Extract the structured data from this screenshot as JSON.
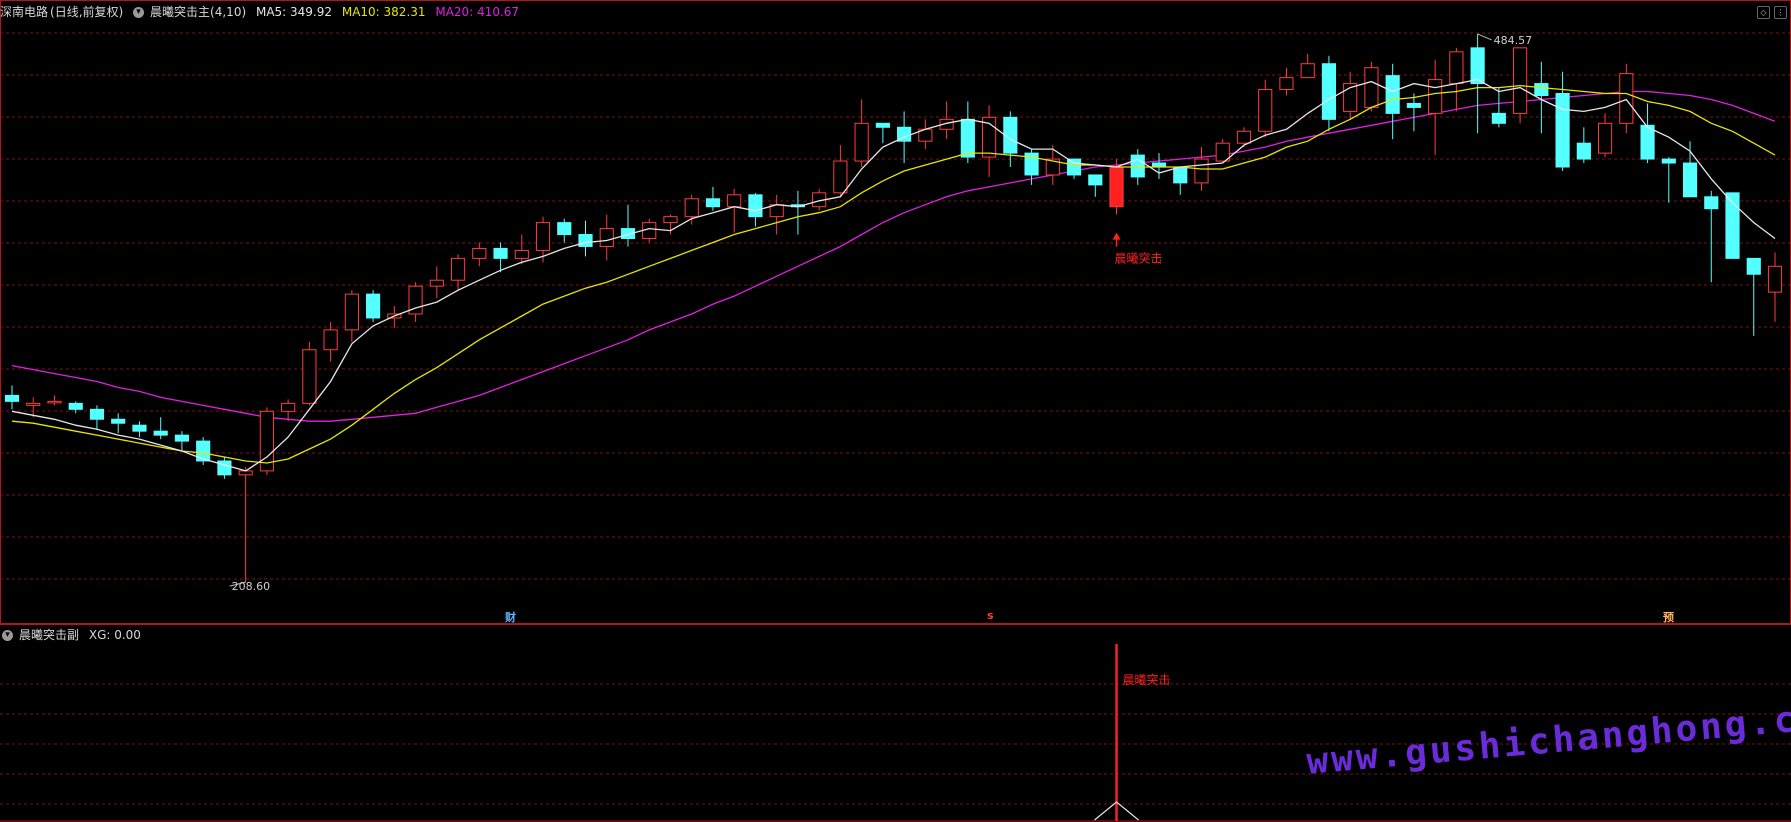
{
  "header": {
    "stock_name": "深南电路",
    "period": "(日线,前复权)",
    "indicator_name": "晨曦突击主",
    "indicator_params": "(4,10)",
    "ma5_label": "MA5: 349.92",
    "ma10_label": "MA10: 382.31",
    "ma20_label": "MA20: 410.67"
  },
  "sub_header": {
    "indicator_name": "晨曦突击副",
    "xg_label": "XG: 0.00"
  },
  "annotations": {
    "high_price": "484.57",
    "low_price": "208.60",
    "signal_main": "晨曦突击",
    "signal_sub": "晨曦突击",
    "marker_cai": "财",
    "marker_s": "s",
    "marker_yu": "预"
  },
  "watermark": "www.gushichanghong.com",
  "colors": {
    "up": "#ff3c3c",
    "down": "#54ffff",
    "ma5": "#e6e6e6",
    "ma10": "#e6e600",
    "ma20": "#e020e0",
    "grid": "#7a1414",
    "signal": "#ff2020"
  },
  "chart_data": {
    "type": "candlestick",
    "ylim": [
      200,
      490
    ],
    "signal_index": 52,
    "candles": [
      [
        303,
        300,
        308,
        296
      ],
      [
        298,
        299,
        302,
        292
      ],
      [
        300,
        300,
        303,
        298
      ],
      [
        299,
        296,
        300,
        294
      ],
      [
        296,
        291,
        298,
        286
      ],
      [
        291,
        289,
        294,
        284
      ],
      [
        288,
        285,
        290,
        282
      ],
      [
        285,
        283,
        292,
        281
      ],
      [
        283,
        280,
        285,
        275
      ],
      [
        280,
        270,
        282,
        268
      ],
      [
        270,
        263,
        272,
        261
      ],
      [
        263,
        265,
        267,
        209
      ],
      [
        265,
        295,
        297,
        263
      ],
      [
        295,
        299,
        301,
        290
      ],
      [
        299,
        326,
        330,
        298
      ],
      [
        326,
        336,
        340,
        320
      ],
      [
        336,
        354,
        356,
        330
      ],
      [
        354,
        342,
        356,
        340
      ],
      [
        342,
        344,
        348,
        337
      ],
      [
        344,
        358,
        360,
        340
      ],
      [
        358,
        361,
        368,
        352
      ],
      [
        361,
        372,
        374,
        356
      ],
      [
        372,
        377,
        380,
        368
      ],
      [
        377,
        372,
        380,
        365
      ],
      [
        372,
        376,
        384,
        369
      ],
      [
        376,
        390,
        393,
        370
      ],
      [
        390,
        384,
        392,
        380
      ],
      [
        384,
        378,
        391,
        373
      ],
      [
        378,
        387,
        394,
        371
      ],
      [
        387,
        382,
        399,
        378
      ],
      [
        382,
        390,
        392,
        380
      ],
      [
        390,
        393,
        394,
        384
      ],
      [
        393,
        402,
        404,
        389
      ],
      [
        402,
        398,
        408,
        396
      ],
      [
        398,
        404,
        407,
        385
      ],
      [
        404,
        393,
        405,
        388
      ],
      [
        393,
        399,
        404,
        384
      ],
      [
        399,
        398,
        406,
        384
      ],
      [
        398,
        405,
        407,
        396
      ],
      [
        405,
        421,
        429,
        403
      ],
      [
        421,
        440,
        452,
        418
      ],
      [
        440,
        438,
        440,
        430
      ],
      [
        438,
        431,
        446,
        420
      ],
      [
        431,
        437,
        442,
        427
      ],
      [
        437,
        442,
        451,
        432
      ],
      [
        442,
        423,
        451,
        420
      ],
      [
        423,
        443,
        449,
        413
      ],
      [
        443,
        425,
        446,
        418
      ],
      [
        425,
        414,
        427,
        409
      ],
      [
        414,
        422,
        429,
        409
      ],
      [
        422,
        414,
        420,
        412
      ],
      [
        414,
        409,
        411,
        403
      ],
      [
        398,
        418,
        422,
        394
      ],
      [
        424,
        413,
        427,
        409
      ],
      [
        420,
        418,
        425,
        412
      ],
      [
        418,
        410,
        416,
        404
      ],
      [
        410,
        422,
        428,
        406
      ],
      [
        421,
        430,
        432,
        420
      ],
      [
        430,
        436,
        438,
        428
      ],
      [
        436,
        457,
        462,
        433
      ],
      [
        457,
        463,
        468,
        454
      ],
      [
        463,
        470,
        475,
        464
      ],
      [
        470,
        442,
        474,
        436
      ],
      [
        446,
        460,
        466,
        442
      ],
      [
        448,
        468,
        471,
        446
      ],
      [
        464,
        445,
        470,
        432
      ],
      [
        450,
        448,
        455,
        436
      ],
      [
        445,
        462,
        472,
        424
      ],
      [
        460,
        476,
        478,
        446
      ],
      [
        478,
        460,
        485,
        435
      ],
      [
        445,
        440,
        458,
        438
      ],
      [
        445,
        478,
        475,
        440
      ],
      [
        460,
        454,
        471,
        435
      ],
      [
        455,
        418,
        466,
        416
      ],
      [
        430,
        422,
        438,
        420
      ],
      [
        425,
        440,
        445,
        423
      ],
      [
        440,
        465,
        470,
        435
      ],
      [
        439,
        422,
        450,
        420
      ],
      [
        422,
        420,
        423,
        400
      ],
      [
        420,
        403,
        431,
        405
      ],
      [
        403,
        397,
        406,
        360
      ],
      [
        405,
        372,
        396,
        372
      ],
      [
        372,
        364,
        372,
        333
      ],
      [
        355,
        368,
        375,
        340
      ]
    ],
    "ma5": [
      295,
      293,
      291,
      288,
      286,
      283,
      281,
      278,
      275,
      271,
      268,
      265,
      272,
      282,
      296,
      310,
      329,
      338,
      343,
      347,
      350,
      356,
      361,
      366,
      370,
      373,
      377,
      380,
      381,
      384,
      387,
      386,
      392,
      395,
      398,
      396,
      399,
      398,
      401,
      403,
      417,
      428,
      433,
      437,
      440,
      442,
      440,
      432,
      427,
      427,
      420,
      419,
      418,
      422,
      415,
      418,
      419,
      420,
      429,
      434,
      437,
      445,
      452,
      458,
      461,
      456,
      460,
      458,
      460,
      462,
      456,
      458,
      452,
      447,
      446,
      448,
      452,
      438,
      433,
      426,
      412,
      400,
      390,
      382
    ],
    "ma10": [
      290,
      289,
      287,
      285,
      283,
      281,
      279,
      277,
      275,
      274,
      272,
      270,
      269,
      271,
      276,
      281,
      288,
      296,
      304,
      311,
      317,
      324,
      331,
      337,
      343,
      349,
      353,
      357,
      360,
      364,
      368,
      372,
      376,
      380,
      384,
      387,
      390,
      393,
      395,
      398,
      405,
      411,
      416,
      419,
      422,
      425,
      425,
      424,
      423,
      421,
      419,
      419,
      418,
      418,
      418,
      418,
      417,
      417,
      420,
      423,
      428,
      431,
      437,
      442,
      448,
      452,
      453,
      455,
      456,
      458,
      458,
      459,
      458,
      457,
      456,
      455,
      455,
      451,
      449,
      446,
      440,
      436,
      430,
      424
    ],
    "ma20": [
      318,
      316,
      314,
      312,
      310,
      307,
      305,
      302,
      300,
      298,
      296,
      294,
      292,
      291,
      290,
      290,
      291,
      292,
      293,
      294,
      297,
      300,
      303,
      307,
      311,
      315,
      319,
      323,
      327,
      331,
      336,
      340,
      344,
      349,
      353,
      358,
      363,
      368,
      373,
      378,
      384,
      390,
      395,
      399,
      403,
      406,
      408,
      410,
      412,
      414,
      416,
      418,
      419,
      420,
      421,
      422,
      423,
      424,
      426,
      428,
      431,
      433,
      435,
      437,
      439,
      441,
      443,
      445,
      447,
      449,
      450,
      451,
      452,
      453,
      454,
      455,
      456,
      456,
      455,
      454,
      452,
      449,
      445,
      441
    ]
  }
}
